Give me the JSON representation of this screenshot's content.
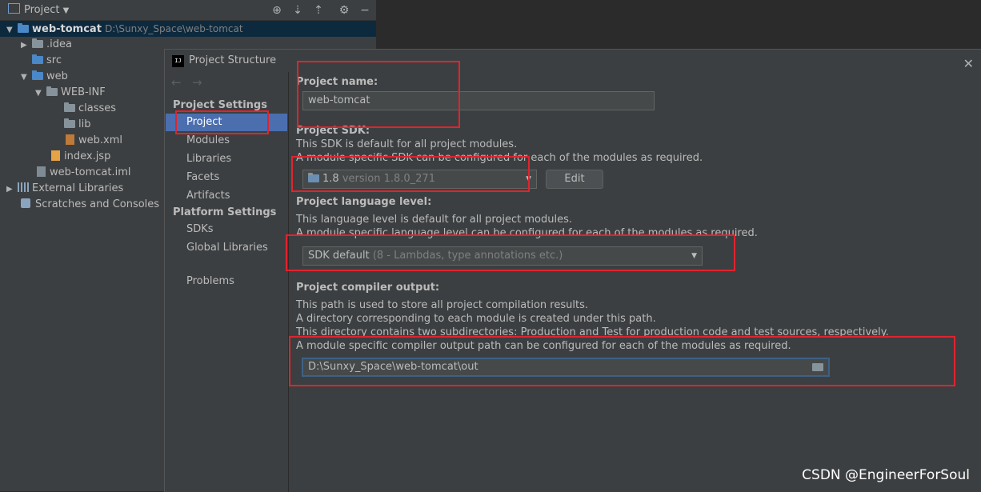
{
  "project_panel": {
    "title": "Project",
    "tree": [
      {
        "label": "web-tomcat",
        "path": "D:\\Sunxy_Space\\web-tomcat"
      },
      {
        "label": ".idea"
      },
      {
        "label": "src"
      },
      {
        "label": "web"
      },
      {
        "label": "WEB-INF"
      },
      {
        "label": "classes"
      },
      {
        "label": "lib"
      },
      {
        "label": "web.xml"
      },
      {
        "label": "index.jsp"
      },
      {
        "label": "web-tomcat.iml"
      },
      {
        "label": "External Libraries"
      },
      {
        "label": "Scratches and Consoles"
      }
    ]
  },
  "dialog": {
    "title": "Project Structure",
    "nav": {
      "project_settings_header": "Project Settings",
      "project_settings": [
        "Project",
        "Modules",
        "Libraries",
        "Facets",
        "Artifacts"
      ],
      "platform_settings_header": "Platform Settings",
      "platform_settings": [
        "SDKs",
        "Global Libraries"
      ],
      "problems": "Problems"
    },
    "content": {
      "name_label": "Project name:",
      "name_value": "web-tomcat",
      "sdk_label": "Project SDK:",
      "sdk_desc1": "This SDK is default for all project modules.",
      "sdk_desc2": "A module specific SDK can be configured for each of the modules as required.",
      "sdk_value": "1.8",
      "sdk_version": "version 1.8.0_271",
      "edit_button": "Edit",
      "lang_label": "Project language level:",
      "lang_desc1": "This language level is default for all project modules.",
      "lang_desc2": "A module specific language level can be configured for each of the modules as required.",
      "lang_value": "SDK default",
      "lang_hint": "(8 - Lambdas, type annotations etc.)",
      "out_label": "Project compiler output:",
      "out_desc1": "This path is used to store all project compilation results.",
      "out_desc2": "A directory corresponding to each module is created under this path.",
      "out_desc3": "This directory contains two subdirectories: Production and Test for production code and test sources, respectively.",
      "out_desc4": "A module specific compiler output path can be configured for each of the modules as required.",
      "out_value": "D:\\Sunxy_Space\\web-tomcat\\out"
    }
  },
  "watermark": "CSDN @EngineerForSoul",
  "colors": {
    "highlight_box": "#e0242e",
    "selection": "#4b6eaf"
  }
}
